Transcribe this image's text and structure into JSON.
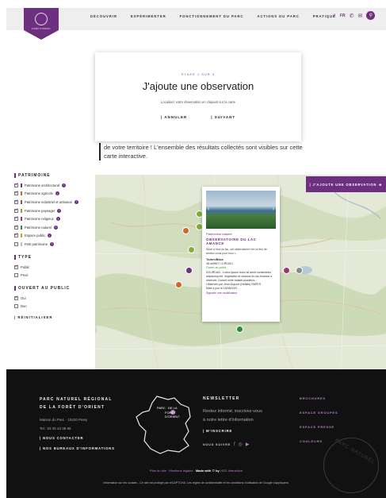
{
  "nav": {
    "items": [
      "DÉCOUVRIR",
      "EXPÉRIMENTER",
      "FONCTIONNEMENT DU PARC",
      "ACTIONS DU PARC",
      "PRATIQUE"
    ],
    "lang": "FR",
    "logo_text": "FORÊT D'ORIENT"
  },
  "modal": {
    "step": "ÉTAPE 1 SUR 3",
    "title": "J'ajoute une observation",
    "hint": "Localisez votre observation en cliquant sur la carte",
    "cancel": "| ANNULER",
    "next": "| SUIVANT"
  },
  "intro": "de votre territoire ! L'ensemble des résultats collectés sont visibles sur cette carte interactive.",
  "filters": {
    "patrimoine": {
      "title": "PATRIMOINE",
      "items": [
        {
          "label": "Patrimoine architectural",
          "checked": true,
          "color": "#6d2f7f"
        },
        {
          "label": "Patrimoine agricole",
          "checked": true,
          "color": "#c86a2a"
        },
        {
          "label": "Patrimoine industriel et artisanal",
          "checked": true,
          "color": "#8a5c3c"
        },
        {
          "label": "Patrimoine paysager",
          "checked": true,
          "color": "#7fae3a"
        },
        {
          "label": "Patrimoine religieux",
          "checked": true,
          "color": "#9a3a6a"
        },
        {
          "label": "Patrimoine naturel",
          "checked": true,
          "color": "#2f8a3a"
        },
        {
          "label": "Espace public",
          "checked": true,
          "color": "#d0a020"
        },
        {
          "label": "Petit patrimoine",
          "checked": false,
          "color": "#c0c0c0"
        }
      ]
    },
    "type": {
      "title": "TYPE",
      "items": [
        {
          "label": "Public",
          "checked": true
        },
        {
          "label": "Privé",
          "checked": false
        }
      ]
    },
    "ouvert": {
      "title": "OUVERT AU PUBLIC",
      "items": [
        {
          "label": "Oui",
          "checked": true
        },
        {
          "label": "Non",
          "checked": false
        }
      ]
    },
    "reset": "| RÉINITIALISER"
  },
  "map": {
    "add_button": "| J'AJOUTE UNE OBSERVATION",
    "markers": [
      {
        "color": "#7fae3a"
      },
      {
        "color": "#7fae3a"
      },
      {
        "color": "#c86a2a"
      },
      {
        "color": "#7fae3a"
      },
      {
        "color": "#6d2f7f"
      },
      {
        "color": "#c86a2a"
      },
      {
        "color": "#9a3a6a"
      },
      {
        "color": "#8a8a8a"
      },
      {
        "color": "#2f8a3a"
      }
    ],
    "popup": {
      "category": "Patrimoine naturel",
      "title": "OBSERVATOIRE DU LAC AMANCE",
      "text": "Situé à l'est du lac, cet observatoire est un lieu de rendez-vous pour tous l...",
      "author_label": "Tezten/Base",
      "coords": "48.xx9967 / 4.3¶1610",
      "status": "Ouvert au public",
      "note": "DOURDAN - Lorem ipsum dolor sit amet consectetur adipiscing elit. Vegetation et oiseaux du lac Amance a observer. Durant notre balade plusieurs...",
      "contrib": "Observée par Jean-Dupont (Hetiles) RAPES",
      "date": "Mise à jour le 15/08/2022",
      "link": "Signaler une modification"
    }
  },
  "footer": {
    "park_lines": [
      "PARC NATUREL RÉGIONAL",
      "DE LA FORÊT D'ORIENT"
    ],
    "address": "Maison du Parc · 10220 Piney",
    "phone": "Tel.: 03 25 43 38 88",
    "links": [
      "NOUS CONTACTER",
      "NOS BUREAUX D'INFORMATIONS"
    ],
    "map_labels": [
      "PARC",
      "DE LA",
      "FORÊT",
      "D'ORIENT"
    ],
    "newsletter": {
      "title": "NEWSLETTER",
      "text_lines": [
        "Restez informé, inscrivez-vous",
        "à notre lettre d'information"
      ],
      "register": "M'INSCRIRE",
      "follow": "NOUS SUIVRE",
      "social": [
        "f",
        "◎",
        "▶"
      ]
    },
    "right_links": [
      "BROCHURES",
      "ESPACE GROUPES",
      "ESPACE PRESSE",
      "COULEURS"
    ],
    "bottom": {
      "left": "Plan du site · Mentions légales · ",
      "made": "Made with ♡ by",
      "agency": " HDD Interactive",
      "cookie": "Information sur les cookies - Ce site est protégé par reCAPTCHA. Les règles de confidentialité et les conditions d'utilisation de Google s'appliquent."
    },
    "stamp": "PARC NATUREL"
  },
  "colors": {
    "brand": "#6d2f7f",
    "footer_bg": "#111111",
    "map_bg": "#e9ecde"
  }
}
